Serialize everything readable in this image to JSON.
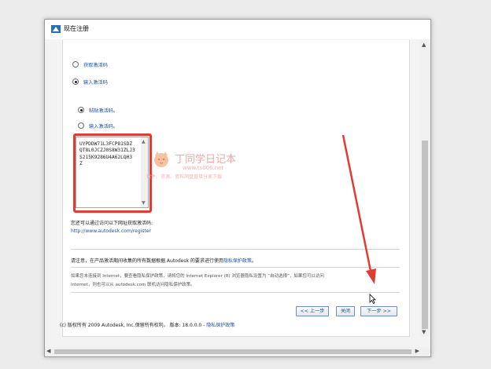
{
  "window": {
    "title": "现在注册"
  },
  "options": {
    "online_label": "获取激活码",
    "enter_label": "输入激活码",
    "paste_label": "粘贴激活码。",
    "type_label": "输入激活码。"
  },
  "activation_code": {
    "lines": [
      "UYPDDW71L3FCP81SDZ",
      "QT8L0JCZJ0S8W31ZLJ3",
      "S215K9286U4A62LQH3",
      "Z"
    ]
  },
  "request": {
    "text": "您还可以通过访问以下网址获取激活码:",
    "link": "http://www.autodesk.com/register"
  },
  "privacy": {
    "notice": "请注意，在产品激活期间收集的所有数据根据 Autodesk 的要求进行使用",
    "notice_link": "隐私保护政策",
    "notice_end": "。",
    "details_line1": "如果您未连接到 Internet，要查看隐私保护政策，请将您的 Internet Explorer (R) 浏览器隐私设置为 “自动选择”，如果您可以访问",
    "details_line2": "Internet，则也可以从 autodesk.com 联机访问隐私保护政策。"
  },
  "buttons": {
    "back": "<< 上一步",
    "close": "关闭",
    "next": "下一步 >>"
  },
  "footer": {
    "copyright": "(c) 版权所有 2009 Autodesk, Inc.保留所有权利。 版本: 18.0.0.0 - ",
    "privacy_link": "隐私保护政策"
  },
  "watermark": {
    "title": "丁同学日记本",
    "url": "www.ts006.net",
    "tagline": "软件、资源、资料网盘直接分享下载"
  },
  "colors": {
    "highlight": "#e23b34",
    "link": "#1c55a6",
    "watermark": "#f4a6a6"
  }
}
